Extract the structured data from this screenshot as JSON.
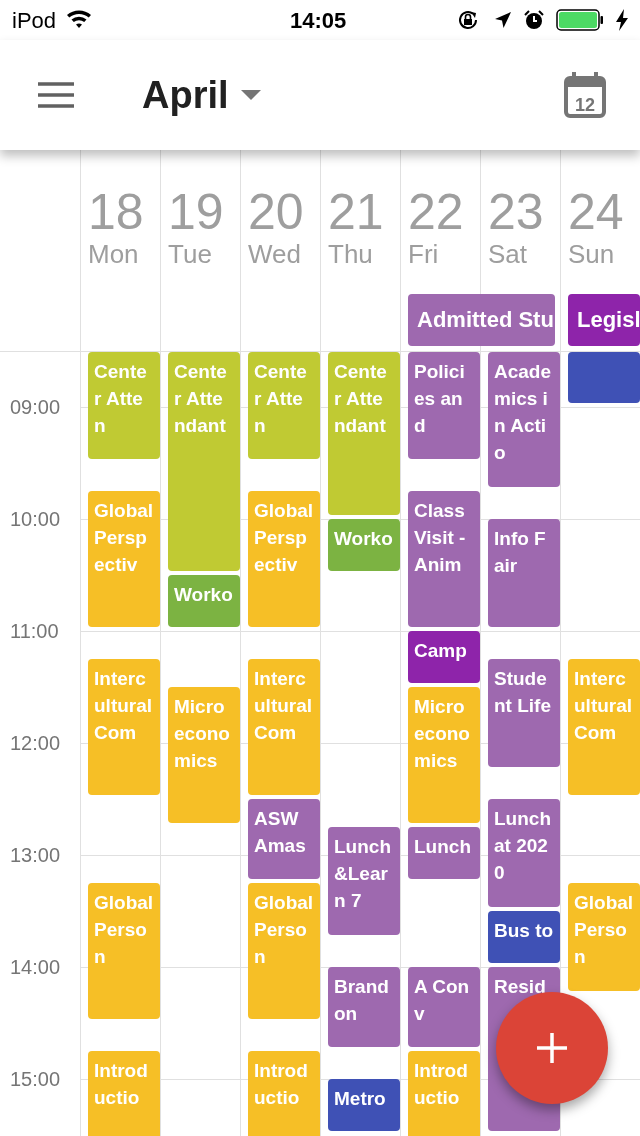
{
  "status_bar": {
    "carrier": "iPod",
    "time": "14:05"
  },
  "app_bar": {
    "title": "April",
    "calendar_day": "12"
  },
  "hours": [
    "09:00",
    "10:00",
    "11:00",
    "12:00",
    "13:00",
    "14:00",
    "15:00"
  ],
  "days": [
    {
      "date": "18",
      "weekday": "Mon",
      "events": [
        {
          "title": "Center Atten",
          "color": "#c0ca33"
        },
        {
          "title": "Global Perspectiv",
          "color": "#f6bf26"
        },
        {
          "title": "Intercultural Com",
          "color": "#f6bf26"
        },
        {
          "title": "Global Person",
          "color": "#f6bf26"
        },
        {
          "title": "Introductio",
          "color": "#f6bf26"
        }
      ]
    },
    {
      "date": "19",
      "weekday": "Tue",
      "events": [
        {
          "title": "Center Attendant",
          "color": "#c0ca33"
        },
        {
          "title": "Worko",
          "color": "#7cb342"
        },
        {
          "title": "Microeconomics",
          "color": "#f6bf26"
        }
      ]
    },
    {
      "date": "20",
      "weekday": "Wed",
      "events": [
        {
          "title": "Center Atten",
          "color": "#c0ca33"
        },
        {
          "title": "Global Perspectiv",
          "color": "#f6bf26"
        },
        {
          "title": "Intercultural Com",
          "color": "#f6bf26"
        },
        {
          "title": "ASW Amas",
          "color": "#9e69af"
        },
        {
          "title": "Global Person",
          "color": "#f6bf26"
        },
        {
          "title": "Introductio",
          "color": "#f6bf26"
        }
      ]
    },
    {
      "date": "21",
      "weekday": "Thu",
      "events": [
        {
          "title": "Center Attendant",
          "color": "#c0ca33"
        },
        {
          "title": "Worko",
          "color": "#7cb342"
        },
        {
          "title": "Lunch&Learn 7",
          "color": "#9e69af"
        },
        {
          "title": "Brandon",
          "color": "#9e69af"
        },
        {
          "title": "Metro",
          "color": "#3f51b5"
        }
      ]
    },
    {
      "date": "22",
      "weekday": "Fri",
      "all_day": {
        "title": "Admitted Stu",
        "color": "#9e69af"
      },
      "events": [
        {
          "title": "Policies and",
          "color": "#9e69af"
        },
        {
          "title": "Class Visit - Anim",
          "color": "#9e69af"
        },
        {
          "title": "Camp",
          "color": "#8e24aa"
        },
        {
          "title": "Microeconomics",
          "color": "#f6bf26"
        },
        {
          "title": "Lunch",
          "color": "#9e69af"
        },
        {
          "title": "A Conv",
          "color": "#9e69af"
        },
        {
          "title": "Introductio",
          "color": "#f6bf26"
        }
      ]
    },
    {
      "date": "23",
      "weekday": "Sat",
      "events": [
        {
          "title": "Academics in Actio",
          "color": "#9e69af"
        },
        {
          "title": "Info Fair",
          "color": "#9e69af"
        },
        {
          "title": "Student Life",
          "color": "#9e69af"
        },
        {
          "title": "Lunch at 2020",
          "color": "#9e69af"
        },
        {
          "title": "Bus to",
          "color": "#3f51b5"
        },
        {
          "title": "Resid",
          "color": "#9e69af"
        }
      ]
    },
    {
      "date": "24",
      "weekday": "Sun",
      "all_day": {
        "title": "Legisl",
        "color": "#8e24aa"
      },
      "events": [
        {
          "color": "#3f51b5"
        },
        {
          "title": "Intercultural Com",
          "color": "#f6bf26"
        },
        {
          "title": "Global Person",
          "color": "#f6bf26"
        }
      ]
    }
  ]
}
